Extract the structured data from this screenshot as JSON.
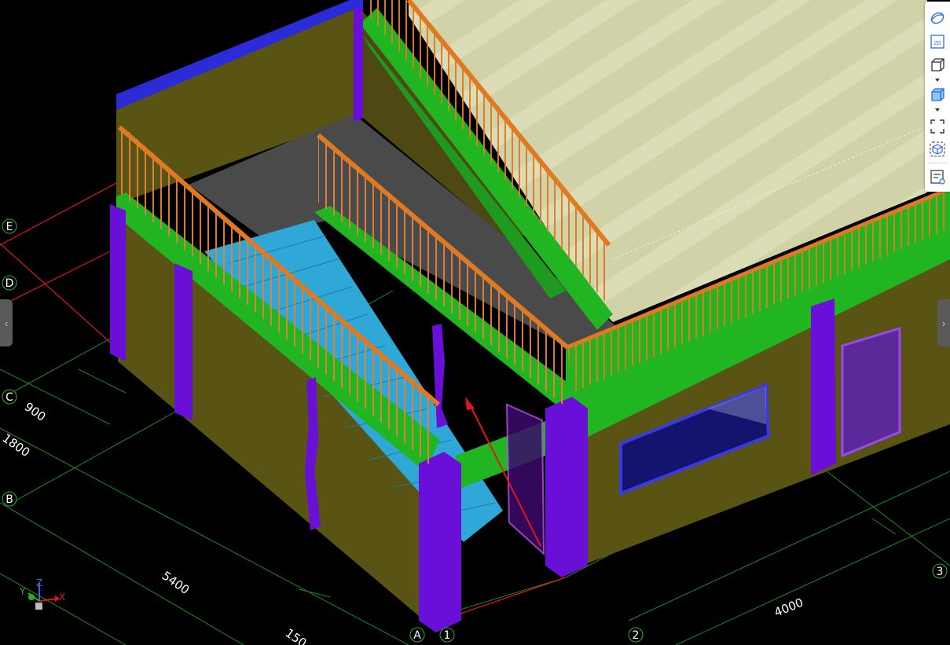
{
  "grid": {
    "rows": [
      "E",
      "D",
      "C",
      "B",
      "A"
    ],
    "cols": [
      "1",
      "2",
      "3"
    ]
  },
  "dimensions": [
    "900",
    "1800",
    "5400",
    "150",
    "4000"
  ],
  "axes": {
    "x": "X",
    "y": "Y",
    "z": "Z"
  },
  "toolbar": {
    "icons": [
      "orbit-icon",
      "2d-view-icon",
      "box-view-icon",
      "shaded-cube-icon",
      "fit-screen-icon",
      "cube-focus-icon",
      "properties-icon"
    ],
    "twod_label": "2D"
  },
  "colors": {
    "wall": "#5a5414",
    "column": "#6a0fd8",
    "beam": "#22b522",
    "railing": "#e07a22",
    "roof": "#d5d5ad",
    "stair": "#2fa8d8",
    "slab": "#4a4a4a",
    "parapet": "#2b2bd8",
    "grid_line": "#1f8a1f",
    "axis_line": "#e01818"
  }
}
